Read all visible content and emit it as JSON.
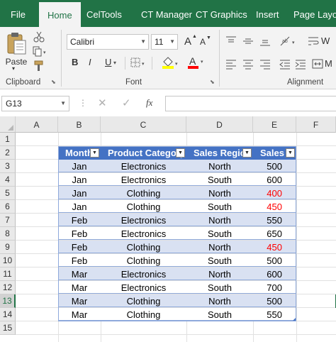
{
  "tabs": [
    {
      "label": "File",
      "active": false
    },
    {
      "label": "Home",
      "active": true
    },
    {
      "label": "CelTools",
      "active": false
    },
    {
      "label": "CT Manager",
      "active": false
    },
    {
      "label": "CT Graphics",
      "active": false
    },
    {
      "label": "Insert",
      "active": false
    },
    {
      "label": "Page Layout",
      "active": false
    }
  ],
  "ribbon": {
    "paste_label": "Paste",
    "clipboard_label": "Clipboard",
    "font_group_label": "Font",
    "alignment_label": "Alignment",
    "font_name": "Calibri",
    "font_size": "11",
    "bold": "B",
    "italic": "I",
    "underline": "U",
    "grow_font": "A",
    "shrink_font": "A",
    "font_color": "A",
    "wrap_text_partial": "W",
    "merge_partial": "M"
  },
  "formula_bar": {
    "name_box": "G13",
    "fx": "fx",
    "formula": ""
  },
  "columns": [
    "A",
    "B",
    "C",
    "D",
    "E",
    "F"
  ],
  "rows": [
    "1",
    "2",
    "3",
    "4",
    "5",
    "6",
    "7",
    "8",
    "9",
    "10",
    "11",
    "12",
    "13",
    "14",
    "15"
  ],
  "table": {
    "headers": [
      "Month",
      "Product Category",
      "Sales Region",
      "Sales"
    ],
    "rows": [
      {
        "month": "Jan",
        "category": "Electronics",
        "region": "North",
        "sales": "500",
        "highlight": false
      },
      {
        "month": "Jan",
        "category": "Electronics",
        "region": "South",
        "sales": "600",
        "highlight": false
      },
      {
        "month": "Jan",
        "category": "Clothing",
        "region": "North",
        "sales": "400",
        "highlight": true
      },
      {
        "month": "Jan",
        "category": "Clothing",
        "region": "South",
        "sales": "450",
        "highlight": true
      },
      {
        "month": "Feb",
        "category": "Electronics",
        "region": "North",
        "sales": "550",
        "highlight": false
      },
      {
        "month": "Feb",
        "category": "Electronics",
        "region": "South",
        "sales": "650",
        "highlight": false
      },
      {
        "month": "Feb",
        "category": "Clothing",
        "region": "North",
        "sales": "450",
        "highlight": true
      },
      {
        "month": "Feb",
        "category": "Clothing",
        "region": "South",
        "sales": "500",
        "highlight": false
      },
      {
        "month": "Mar",
        "category": "Electronics",
        "region": "North",
        "sales": "600",
        "highlight": false
      },
      {
        "month": "Mar",
        "category": "Electronics",
        "region": "South",
        "sales": "700",
        "highlight": false
      },
      {
        "month": "Mar",
        "category": "Clothing",
        "region": "North",
        "sales": "500",
        "highlight": false
      },
      {
        "month": "Mar",
        "category": "Clothing",
        "region": "South",
        "sales": "550",
        "highlight": false
      }
    ]
  },
  "colors": {
    "excel_green": "#217346",
    "table_header": "#4472c4",
    "band": "#d9e1f2",
    "highlight_text": "#ff0000"
  }
}
